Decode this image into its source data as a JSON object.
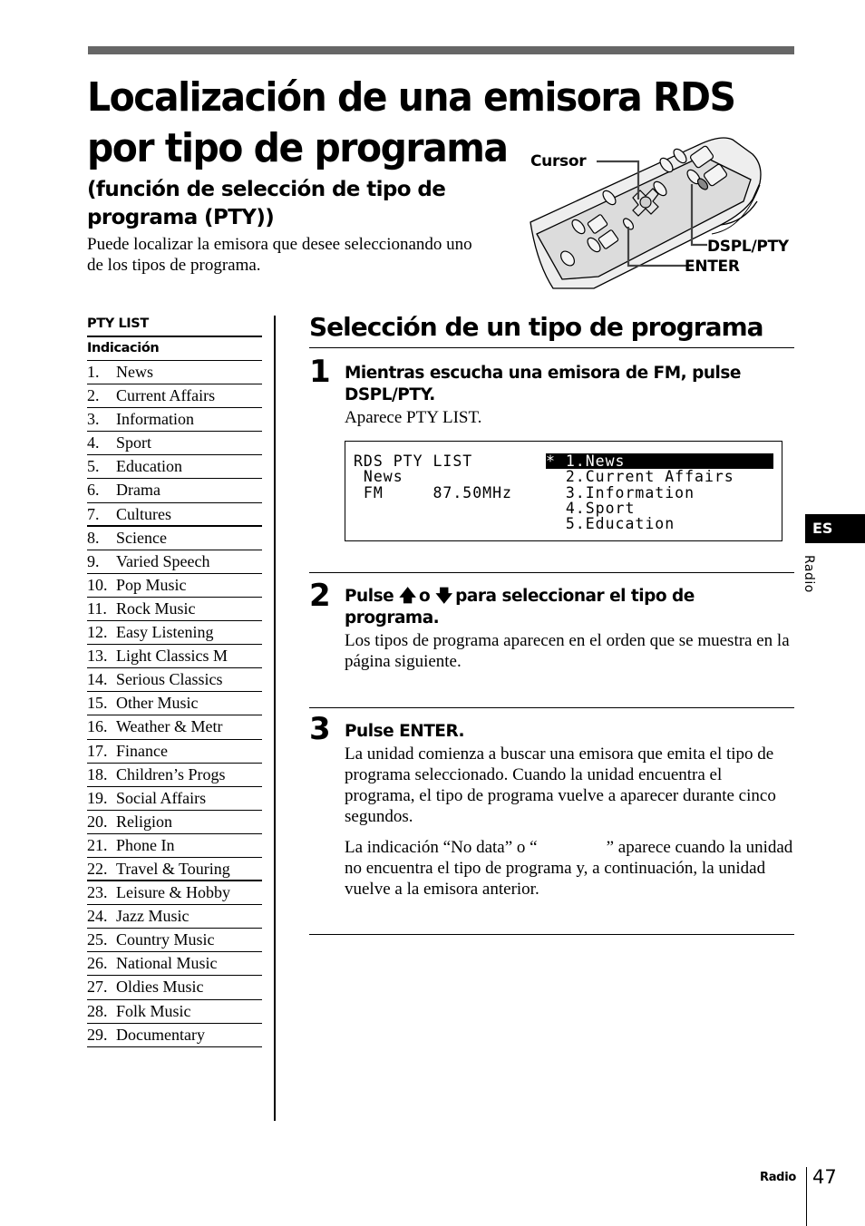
{
  "header": {
    "title_line1": "Localización de una emisora RDS",
    "title_line2": "por tipo de programa",
    "subtitle": "(función de selección de tipo de programa (PTY))",
    "intro": "Puede localizar la emisora que desee seleccionando uno de los tipos de programa."
  },
  "illustration": {
    "labels": {
      "cursor": "Cursor",
      "dspl_pty": "DSPL/PTY",
      "enter": "ENTER"
    }
  },
  "pty_list": {
    "title": "PTY LIST",
    "column_header": "Indicación",
    "items": [
      {
        "num": "1.",
        "label": "News"
      },
      {
        "num": "2.",
        "label": "Current Affairs"
      },
      {
        "num": "3.",
        "label": "Information"
      },
      {
        "num": "4.",
        "label": "Sport"
      },
      {
        "num": "5.",
        "label": "Education"
      },
      {
        "num": "6.",
        "label": "Drama"
      },
      {
        "num": "7.",
        "label": "Cultures"
      },
      {
        "num": "8.",
        "label": "Science"
      },
      {
        "num": "9.",
        "label": "Varied Speech"
      },
      {
        "num": "10.",
        "label": "Pop Music"
      },
      {
        "num": "11.",
        "label": "Rock Music"
      },
      {
        "num": "12.",
        "label": "Easy Listening"
      },
      {
        "num": "13.",
        "label": "Light Classics M"
      },
      {
        "num": "14.",
        "label": "Serious Classics"
      },
      {
        "num": "15.",
        "label": "Other Music"
      },
      {
        "num": "16.",
        "label": "Weather & Metr"
      },
      {
        "num": "17.",
        "label": "Finance"
      },
      {
        "num": "18.",
        "label": "Children’s Progs"
      },
      {
        "num": "19.",
        "label": "Social Affairs"
      },
      {
        "num": "20.",
        "label": "Religion"
      },
      {
        "num": "21.",
        "label": "Phone In"
      },
      {
        "num": "22.",
        "label": "Travel & Touring"
      },
      {
        "num": "23.",
        "label": "Leisure & Hobby"
      },
      {
        "num": "24.",
        "label": "Jazz Music"
      },
      {
        "num": "25.",
        "label": "Country Music"
      },
      {
        "num": "26.",
        "label": "National Music"
      },
      {
        "num": "27.",
        "label": "Oldies Music"
      },
      {
        "num": "28.",
        "label": "Folk Music"
      },
      {
        "num": "29.",
        "label": "Documentary"
      }
    ]
  },
  "section": {
    "title": "Selección de un tipo de programa",
    "steps": [
      {
        "number": "1",
        "heading": "Mientras escucha una emisora de FM, pulse DSPL/PTY.",
        "body": "Aparece PTY LIST."
      },
      {
        "number": "2",
        "heading_pre": "Pulse",
        "heading_or": "o",
        "heading_post": "para seleccionar el tipo de programa.",
        "up_arrow": "🡅",
        "down_arrow": "🡇",
        "body": "Los tipos de programa aparecen en el orden que se muestra en la página siguiente."
      },
      {
        "number": "3",
        "heading": "Pulse ENTER.",
        "body": "La unidad comienza a buscar una emisora que emita el tipo de programa seleccionado. Cuando la unidad encuentra el programa, el tipo de programa vuelve a aparecer durante cinco segundos.",
        "note": "La indicación “No data” o “                ” aparece cuando la unidad no encuentra el tipo de programa y, a continuación, la unidad vuelve a la emisora anterior."
      }
    ]
  },
  "display": {
    "left_lines": [
      "RDS PTY LIST",
      " News",
      " FM     87.50MHz"
    ],
    "right_lines": [
      "* 1.News",
      "  2.Current Affairs",
      "  3.Information",
      "  4.Sport",
      "  5.Education"
    ],
    "selected_index": 0
  },
  "side_tab": {
    "language": "ES",
    "section": "Radio"
  },
  "footer": {
    "section": "Radio",
    "page_number": "47"
  }
}
